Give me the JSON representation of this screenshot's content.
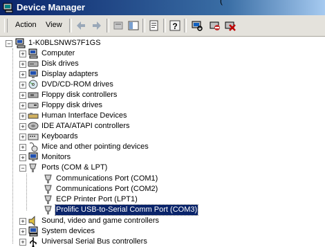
{
  "window": {
    "title": "Device Manager",
    "title_fragment": "("
  },
  "menu": {
    "action": "Action",
    "view": "View"
  },
  "tree": {
    "root": "1-K0BLSNWS7F1GS",
    "items": [
      {
        "label": "Computer",
        "icon": "computer-icon"
      },
      {
        "label": "Disk drives",
        "icon": "disk-drive-icon"
      },
      {
        "label": "Display adapters",
        "icon": "monitor-icon"
      },
      {
        "label": "DVD/CD-ROM drives",
        "icon": "cdrom-icon"
      },
      {
        "label": "Floppy disk controllers",
        "icon": "controller-icon"
      },
      {
        "label": "Floppy disk drives",
        "icon": "floppy-icon"
      },
      {
        "label": "Human Interface Devices",
        "icon": "hid-icon"
      },
      {
        "label": "IDE ATA/ATAPI controllers",
        "icon": "ide-icon"
      },
      {
        "label": "Keyboards",
        "icon": "keyboard-icon"
      },
      {
        "label": "Mice and other pointing devices",
        "icon": "mouse-icon"
      },
      {
        "label": "Monitors",
        "icon": "monitor-icon"
      },
      {
        "label": "Ports (COM & LPT)",
        "icon": "port-icon"
      },
      {
        "label": "Sound, video and game controllers",
        "icon": "speaker-icon"
      },
      {
        "label": "System devices",
        "icon": "system-icon"
      },
      {
        "label": "Universal Serial Bus controllers",
        "icon": "usb-icon"
      }
    ],
    "ports": [
      {
        "label": "Communications Port (COM1)"
      },
      {
        "label": "Communications Port (COM2)"
      },
      {
        "label": "ECP Printer Port (LPT1)"
      },
      {
        "label": "Prolific USB-to-Serial Comm Port (COM3)"
      }
    ],
    "selected": "Prolific USB-to-Serial Comm Port (COM3)"
  }
}
